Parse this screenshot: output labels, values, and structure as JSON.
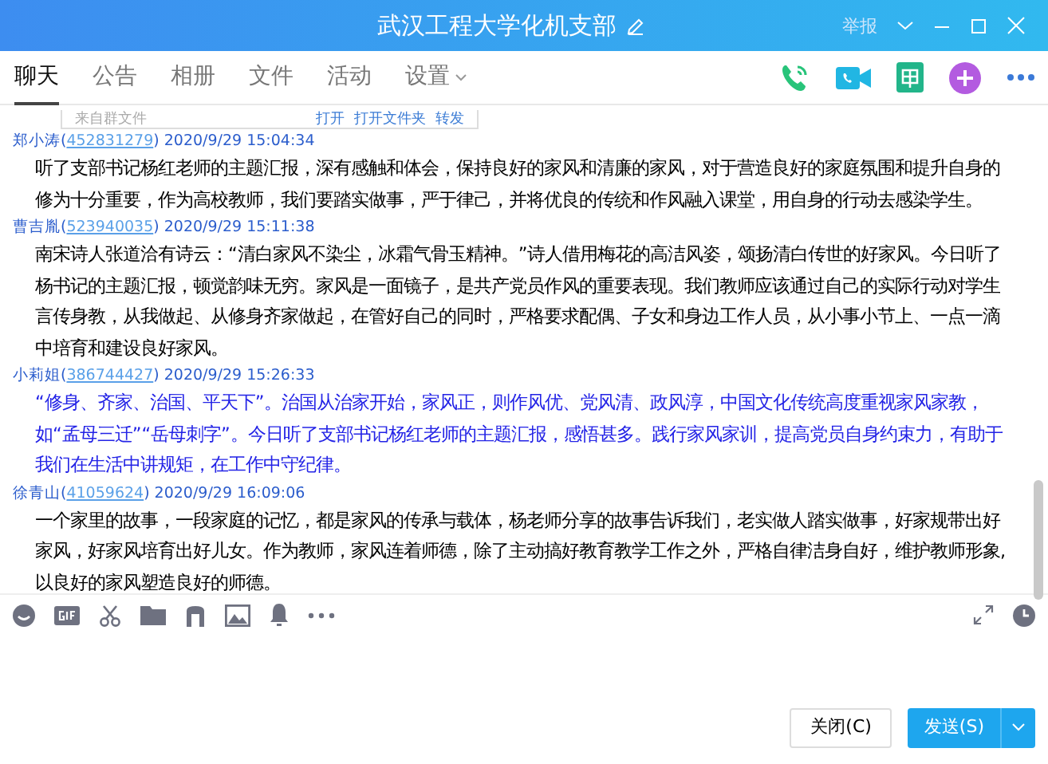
{
  "window": {
    "title": "武汉工程大学化机支部",
    "report": "举报"
  },
  "tabs": [
    {
      "label": "聊天",
      "selected": true
    },
    {
      "label": "公告",
      "selected": false
    },
    {
      "label": "相册",
      "selected": false
    },
    {
      "label": "文件",
      "selected": false
    },
    {
      "label": "活动",
      "selected": false
    },
    {
      "label": "设置",
      "selected": false,
      "dropdown": true
    }
  ],
  "file_card": {
    "source": "来自群文件",
    "actions": [
      "打开",
      "打开文件夹",
      "转发"
    ]
  },
  "messages": [
    {
      "sender": "郑小涛(",
      "qq": "452831279",
      "time": ") 2020/9/29 15:04:34",
      "color": "#000000",
      "text": "听了支部书记杨红老师的主题汇报，深有感触和体会，保持良好的家风和清廉的家风，对于营造良好的家庭氛围和提升自身的修为十分重要，作为高校教师，我们要踏实做事，严于律己，并将优良的传统和作风融入课堂，用自身的行动去感染学生。"
    },
    {
      "sender": "曹吉胤(",
      "qq": "523940035",
      "time": ") 2020/9/29 15:11:38",
      "color": "#000000",
      "text": "南宋诗人张道洽有诗云：“清白家风不染尘，冰霜气骨玉精神。”诗人借用梅花的高洁风姿，颂扬清白传世的好家风。今日听了杨书记的主题汇报，顿觉韵味无穷。家风是一面镜子，是共产党员作风的重要表现。我们教师应该通过自己的实际行动对学生言传身教，从我做起、从修身齐家做起，在管好自己的同时，严格要求配偶、子女和身边工作人员，从小事小节上、一点一滴中培育和建设良好家风。"
    },
    {
      "sender": "小莉姐(",
      "qq": "386744427",
      "time": ") 2020/9/29 15:26:33",
      "color": "#2323e6",
      "text": "“修身、齐家、治国、平天下”。治国从治家开始，家风正，则作风优、党风清、政风淳，中国文化传统高度重视家风家教，如“孟母三迁”“岳母刺字”。今日听了支部书记杨红老师的主题汇报，感悟甚多。践行家风家训，提高党员自身约束力，有助于我们在生活中讲规矩，在工作中守纪律。"
    },
    {
      "sender": "徐青山(",
      "qq": "41059624",
      "time": ") 2020/9/29 16:09:06",
      "color": "#000000",
      "text": "一个家里的故事，一段家庭的记忆，都是家风的传承与载体，杨老师分享的故事告诉我们，老实做人踏实做事，好家规带出好家风，好家风培育出好儿女。作为教师，家风连着师德，除了主动搞好教育教学工作之外，严格自律洁身自好，维护教师形象, 以良好的家风塑造良好的师德。"
    }
  ],
  "buttons": {
    "close": "关闭(C)",
    "send": "发送(S)"
  }
}
